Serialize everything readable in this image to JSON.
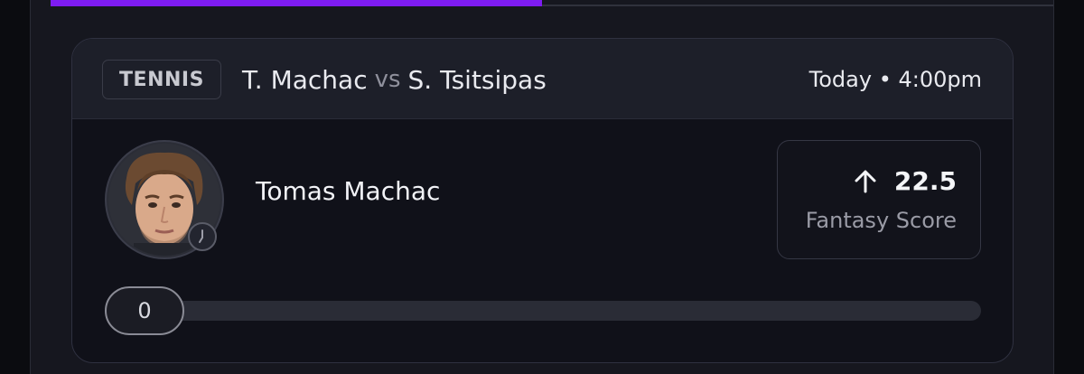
{
  "card": {
    "sport": "TENNIS",
    "player_one": "T. Machac",
    "versus": "vs",
    "player_two": "S. Tsitsipas",
    "datetime": "Today • 4:00pm",
    "player_name": "Tomas Machac",
    "score_direction_icon": "arrow-up-icon",
    "score_value": "22.5",
    "score_label": "Fantasy Score",
    "progress_value": "0",
    "progress_fraction": 0
  },
  "colors": {
    "accent": "#7e1cf2",
    "background": "#0b0c10",
    "card_header": "#1d1f29"
  }
}
